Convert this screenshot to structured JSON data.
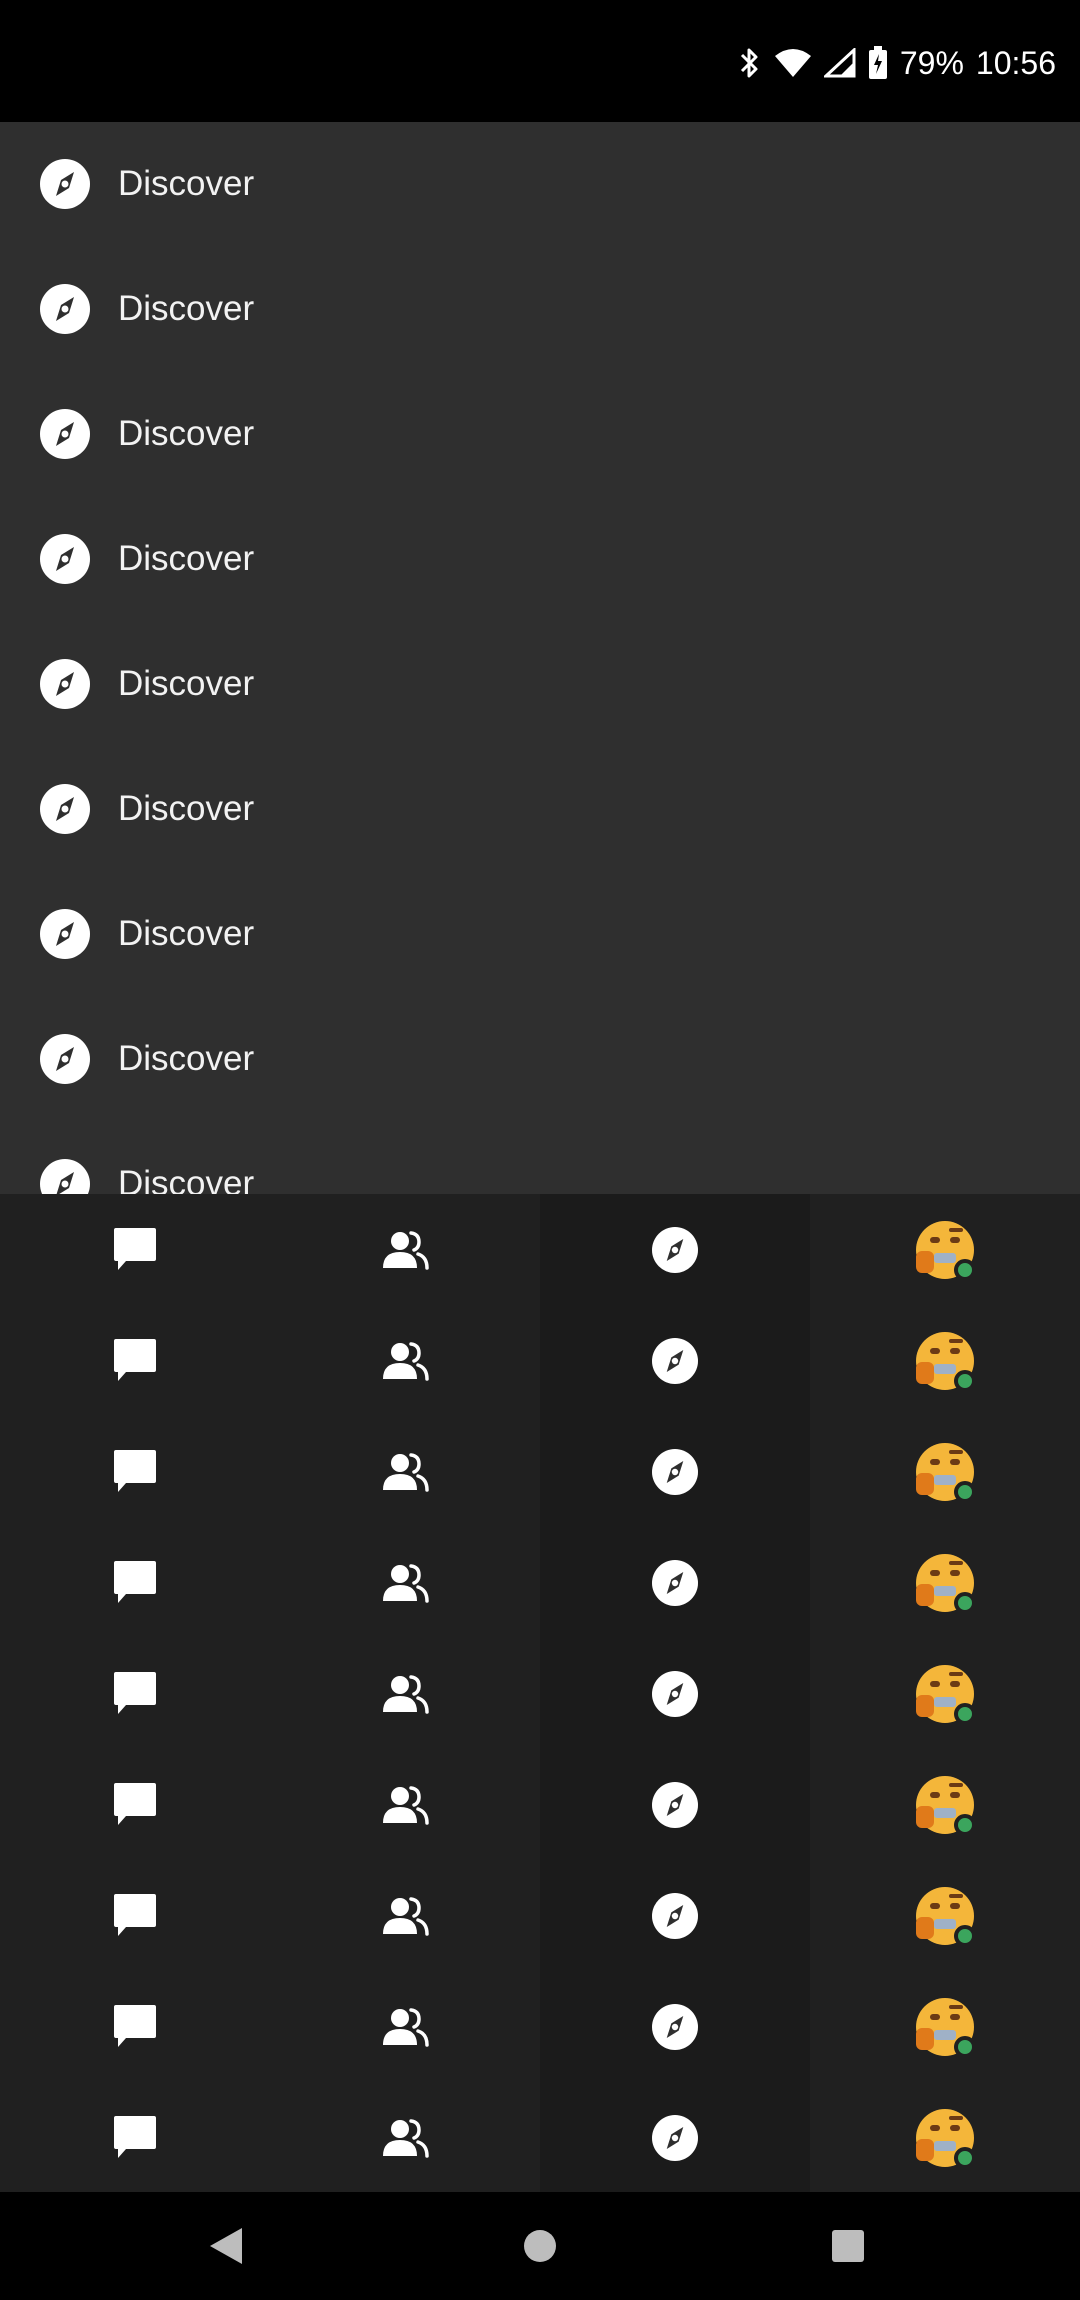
{
  "status_bar": {
    "battery": "79%",
    "time": "10:56",
    "icons": [
      "bluetooth-icon",
      "wifi-icon",
      "cell-signal-icon",
      "battery-charging-icon"
    ]
  },
  "discover_list": {
    "items": [
      {
        "label": "Discover",
        "icon": "compass-icon"
      },
      {
        "label": "Discover",
        "icon": "compass-icon"
      },
      {
        "label": "Discover",
        "icon": "compass-icon"
      },
      {
        "label": "Discover",
        "icon": "compass-icon"
      },
      {
        "label": "Discover",
        "icon": "compass-icon"
      },
      {
        "label": "Discover",
        "icon": "compass-icon"
      },
      {
        "label": "Discover",
        "icon": "compass-icon"
      },
      {
        "label": "Discover",
        "icon": "compass-icon"
      },
      {
        "label": "Discover",
        "icon": "compass-icon"
      }
    ]
  },
  "tab_bar": {
    "tabs": [
      "messages-icon",
      "friends-icon",
      "compass-icon",
      "avatar"
    ],
    "selected_tab_index": 2,
    "row_count": 9,
    "user_status": "online"
  },
  "nav_bar": {
    "buttons": [
      "back-icon",
      "home-icon",
      "recents-icon"
    ]
  },
  "colors": {
    "panel_bg": "#2f2f2f",
    "tab_bg": "#202020",
    "selected_tab_bg": "#1b1b1b",
    "text": "#f2f2f2",
    "online": "#3ba55d"
  }
}
